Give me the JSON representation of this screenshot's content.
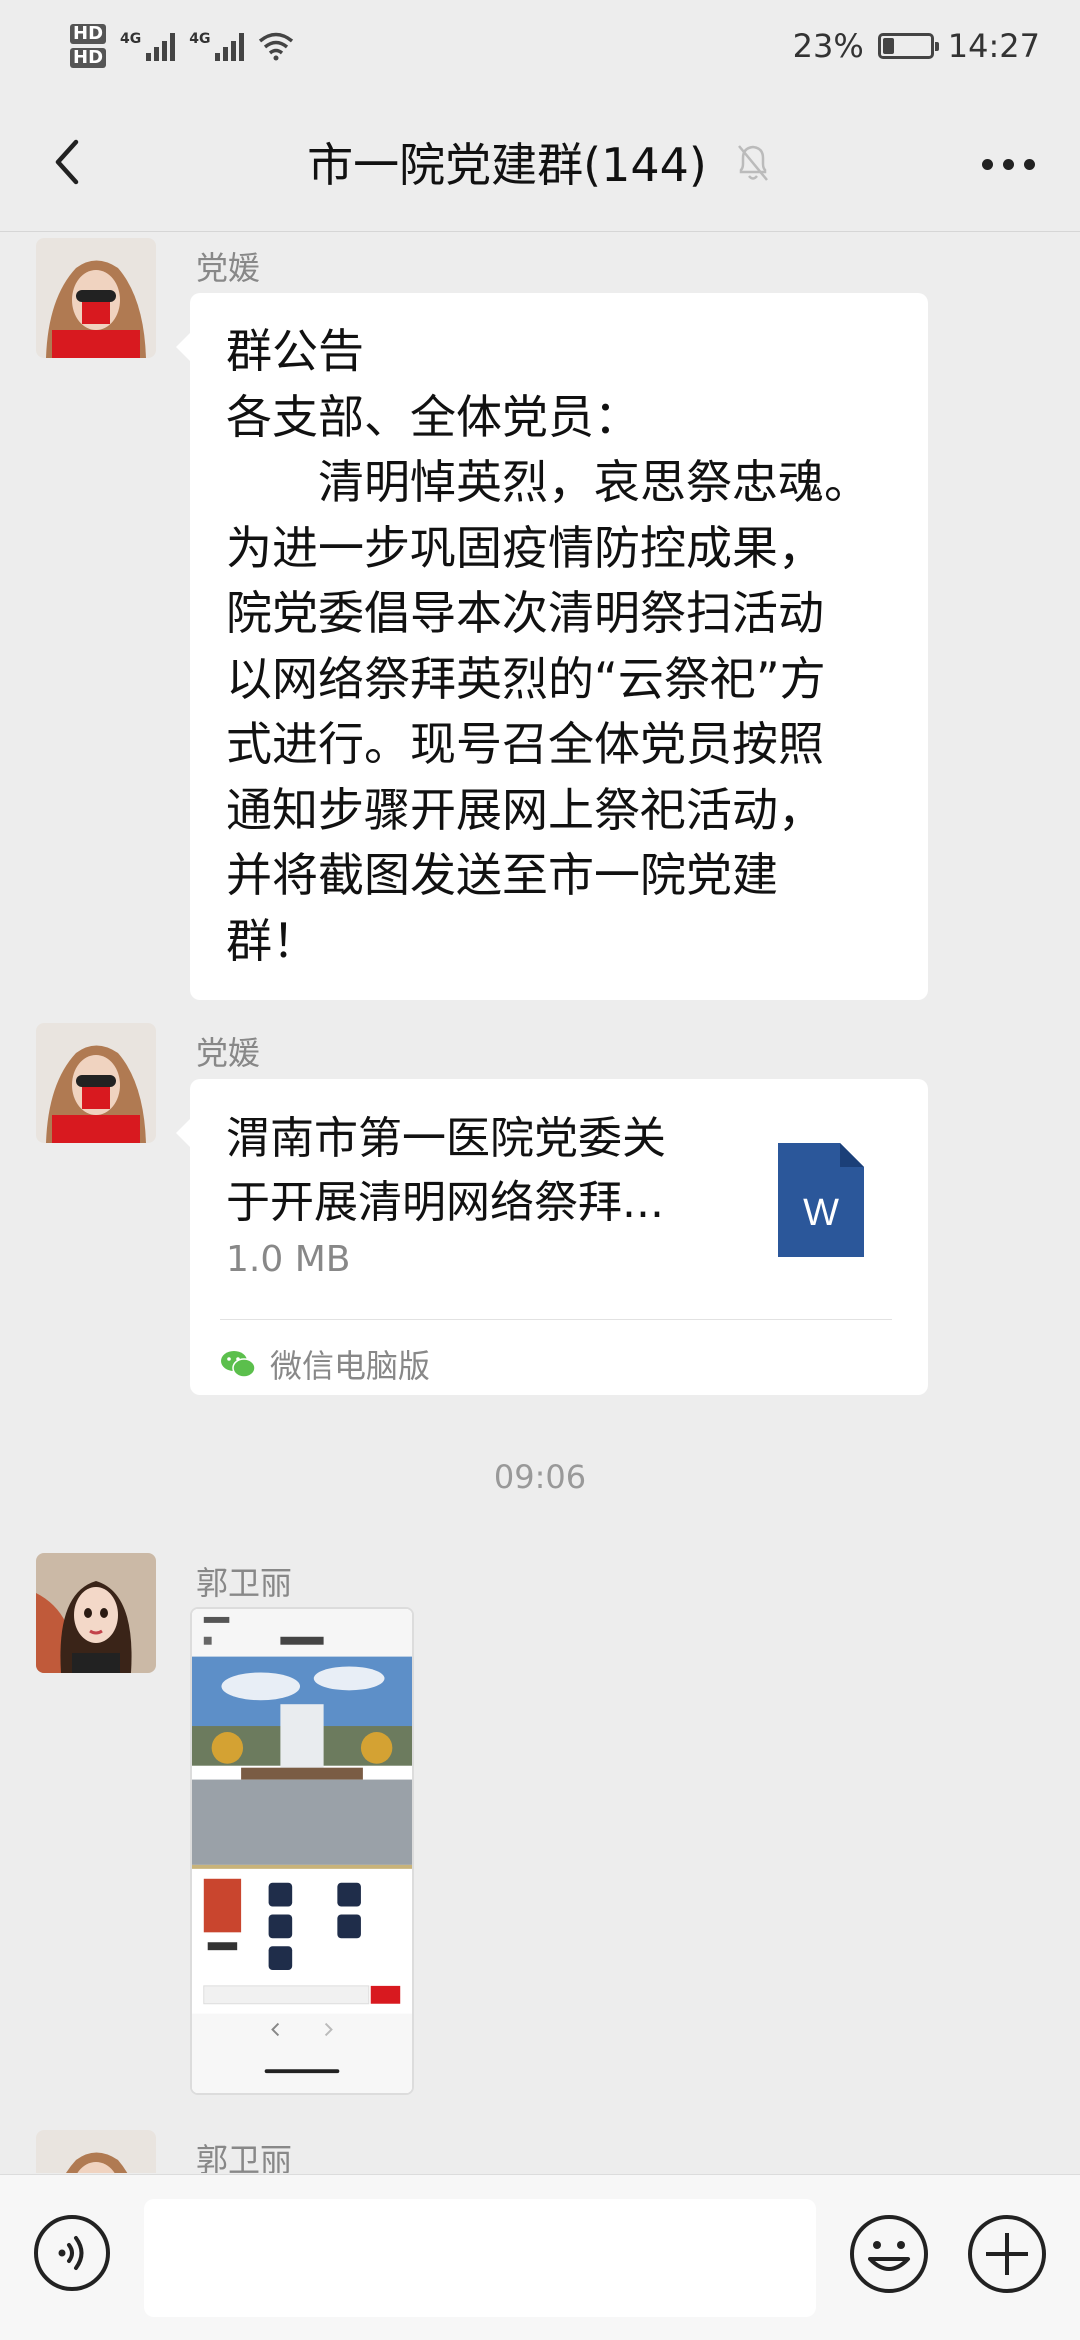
{
  "status_bar": {
    "sim1_label": "HD",
    "sim2_label": "HD",
    "net1": "4G",
    "net2": "4G",
    "battery_percent": "23%",
    "battery_level": 0.23,
    "time": "14:27"
  },
  "header": {
    "title": "市一院党建群(144)",
    "icons": {
      "back": "chevron-left-icon",
      "mute": "bell-muted-icon",
      "more": "more-icon"
    }
  },
  "messages": [
    {
      "type": "text",
      "sender": "党媛",
      "lines": [
        "群公告",
        "各支部、全体党员：",
        "　　清明悼英烈，哀思祭忠魂。",
        "为进一步巩固疫情防控成果，",
        "院党委倡导本次清明祭扫活动",
        "以网络祭拜英烈的“云祭祀”方",
        "式进行。现号召全体党员按照",
        "通知步骤开展网上祭祀活动，",
        "并将截图发送至市一院党建",
        "群！"
      ]
    },
    {
      "type": "file",
      "sender": "党媛",
      "file_name_line1": "渭南市第一医院党委关",
      "file_name_line2": "于开展清明网络祭拜...",
      "file_size": "1.0 MB",
      "file_icon_letter": "W",
      "source": "微信电脑版"
    },
    {
      "type": "time",
      "time": "09:06"
    },
    {
      "type": "image",
      "sender": "郭卫丽",
      "image_desc": "screenshot"
    },
    {
      "type": "partial",
      "sender": "郭卫丽"
    }
  ],
  "input_bar": {
    "icons": {
      "voice": "voice-icon",
      "emoji": "emoji-icon",
      "plus": "plus-icon"
    },
    "placeholder": ""
  },
  "colors": {
    "background": "#ededed",
    "bubble": "#ffffff",
    "doc_blue": "#2b579a",
    "wechat_green": "#5bbf4c"
  }
}
